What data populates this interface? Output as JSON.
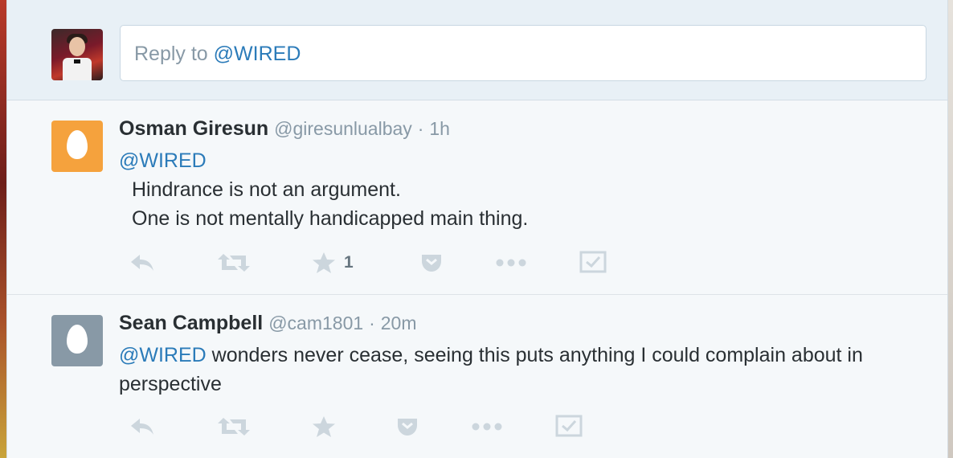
{
  "reply": {
    "prefix": "Reply to ",
    "mention": "@WIRED"
  },
  "tweets": [
    {
      "name": "Osman Giresun",
      "handle": "@giresunlualbay",
      "separator": "·",
      "time": "1h",
      "mention": "@WIRED",
      "lines": [
        "Hindrance is not an argument.",
        "One is not mentally handicapped main thing."
      ],
      "favorite_count": "1",
      "avatar_color": "#f5a23d"
    },
    {
      "name": "Sean Campbell",
      "handle": "@cam1801",
      "separator": "·",
      "time": "20m",
      "mention": "@WIRED",
      "text": " wonders never cease, seeing this puts anything I could complain about in perspective",
      "avatar_color": "#8899a6"
    }
  ],
  "colors": {
    "link": "#2b7bb9",
    "muted": "#8899a6",
    "icon": "#ccd6dd",
    "text": "#292f33"
  },
  "icons": [
    "reply-icon",
    "retweet-icon",
    "favorite-icon",
    "pocket-icon",
    "more-icon",
    "task-icon"
  ]
}
